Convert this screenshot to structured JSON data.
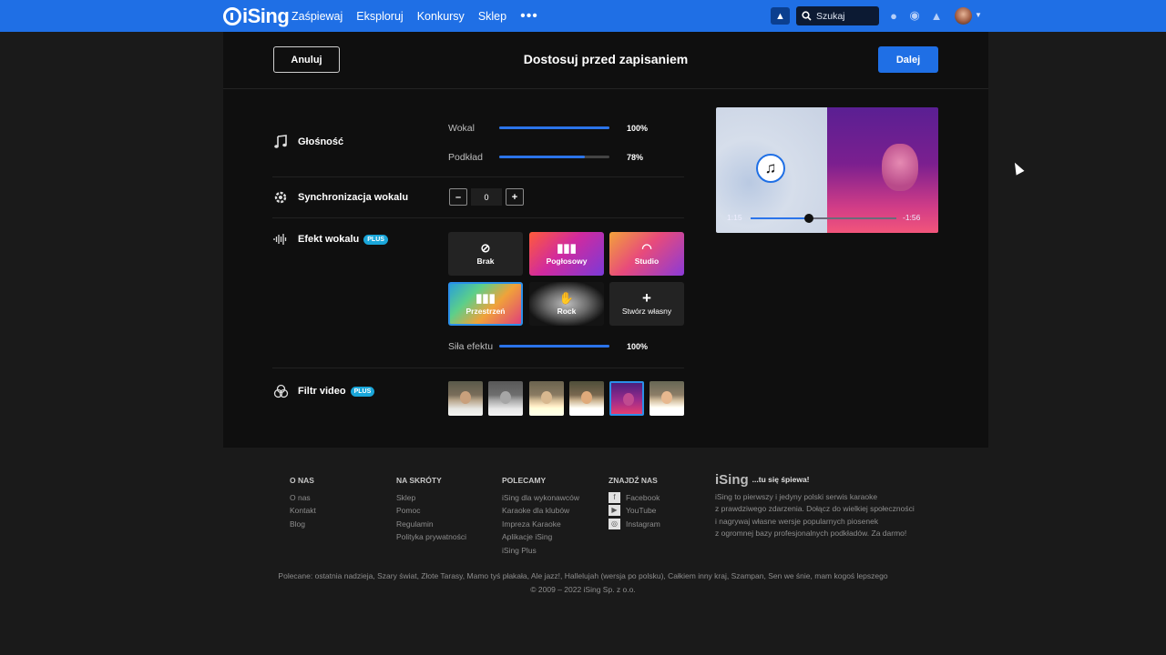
{
  "nav": {
    "logo": "iSing",
    "menu": [
      "Zaśpiewaj",
      "Eksploruj",
      "Konkursy",
      "Sklep"
    ],
    "more": "•••",
    "search_placeholder": "Szukaj"
  },
  "panel": {
    "cancel": "Anuluj",
    "title": "Dostosuj przed zapisaniem",
    "next": "Dalej",
    "volume": {
      "label": "Głośność",
      "vocal_label": "Wokal",
      "vocal_value": "100%",
      "vocal_level": 1.0,
      "backing_label": "Podkład",
      "backing_value": "78%",
      "backing_level": 0.78
    },
    "sync": {
      "label": "Synchronizacja wokalu",
      "minus": "–",
      "value": "0",
      "plus": "+"
    },
    "effect": {
      "label": "Efekt wokalu",
      "badge": "PLUS",
      "options": [
        {
          "label": "Brak",
          "icon": "ban-icon"
        },
        {
          "label": "Pogłosowy",
          "icon": "waveform-icon"
        },
        {
          "label": "Studio",
          "icon": "headphones-icon"
        },
        {
          "label": "Przestrzeń",
          "icon": "bars-icon"
        },
        {
          "label": "Rock",
          "icon": "rock-hand-icon"
        },
        {
          "label": "Stwórz własny",
          "icon": "plus-icon"
        }
      ],
      "selected": "Przestrzeń",
      "strength_label": "Siła efektu",
      "strength_value": "100%",
      "strength_level": 1.0
    },
    "video_filter": {
      "label": "Filtr video",
      "badge": "PLUS",
      "selected_index": 4
    },
    "preview": {
      "time_current": "1:15",
      "time_remaining": "-1:56",
      "progress": 0.4
    }
  },
  "footer": {
    "col1": {
      "head": "O NAS",
      "items": [
        "O nas",
        "Kontakt",
        "Blog"
      ]
    },
    "col2": {
      "head": "NA SKRÓTY",
      "items": [
        "Sklep",
        "Pomoc",
        "Regulamin",
        "Polityka prywatności"
      ]
    },
    "col3": {
      "head": "POLECAMY",
      "items": [
        "iSing dla wykonawców",
        "Karaoke dla klubów",
        "Impreza Karaoke",
        "Aplikacje iSing",
        "iSing Plus"
      ]
    },
    "col4": {
      "head": "ZNAJDŹ NAS",
      "items": [
        "Facebook",
        "YouTube",
        "Instagram"
      ]
    },
    "brand": {
      "logo": "iSing",
      "tagline": "...tu się śpiewa!",
      "lines": [
        "iSing to pierwszy i jedyny polski serwis karaoke",
        "z prawdziwego zdarzenia. Dołącz do wielkiej społeczności",
        "i nagrywaj własne wersje popularnych piosenek",
        "z ogromnej bazy profesjonalnych podkładów. Za darmo!"
      ]
    },
    "recommended": "Polecane: ostatnia nadzieja, Szary świat, Złote Tarasy, Mamo tyś płakała, Ale jazz!, Hallelujah (wersja po polsku), Całkiem inny kraj, Szampan, Sen we śnie, mam kogoś lepszego",
    "copyright": "© 2009 – 2022 iSing Sp. z o.o."
  }
}
